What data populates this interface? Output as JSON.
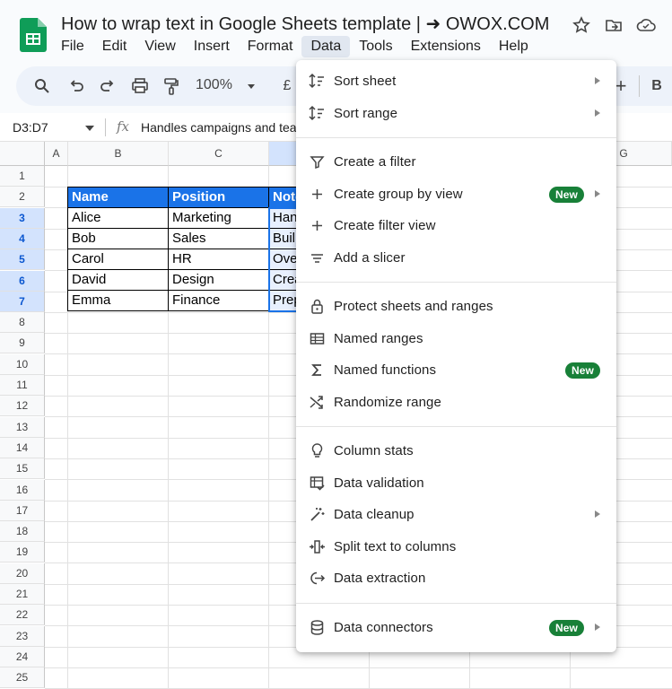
{
  "header": {
    "title": "How to wrap text in Google Sheets template | ➜ OWOX.COM",
    "menus": [
      "File",
      "Edit",
      "View",
      "Insert",
      "Format",
      "Data",
      "Tools",
      "Extensions",
      "Help"
    ],
    "active_menu": "Data"
  },
  "toolbar": {
    "zoom": "100%",
    "currency": "£",
    "bold": "B",
    "plus": "+"
  },
  "formula_bar": {
    "name_box": "D3:D7",
    "fx": "fx",
    "content": "Handles campaigns and tear"
  },
  "grid": {
    "columns": [
      "A",
      "B",
      "C",
      "",
      "G"
    ],
    "rows": [
      "1",
      "2",
      "3",
      "4",
      "5",
      "6",
      "7",
      "8",
      "9",
      "10",
      "11",
      "12",
      "13",
      "14",
      "15",
      "16",
      "17",
      "18",
      "19",
      "20",
      "21",
      "22",
      "23",
      "24",
      "25"
    ],
    "table_headers": [
      "Name",
      "Position",
      "Note"
    ],
    "table_rows": [
      [
        "Alice",
        "Marketing",
        "Han"
      ],
      [
        "Bob",
        "Sales",
        "Buil"
      ],
      [
        "Carol",
        "HR",
        "Ove"
      ],
      [
        "David",
        "Design",
        "Crea"
      ],
      [
        "Emma",
        "Finance",
        "Prep"
      ]
    ]
  },
  "data_menu": {
    "items": [
      {
        "label": "Sort sheet",
        "icon": "sort-sheet-icon"
      },
      {
        "label": "Sort range",
        "icon": "sort-range-icon"
      },
      {
        "label": "Create a filter",
        "icon": "filter-icon"
      },
      {
        "label": "Create group by view",
        "icon": "plus-icon",
        "badge": "New"
      },
      {
        "label": "Create filter view",
        "icon": "plus-icon"
      },
      {
        "label": "Add a slicer",
        "icon": "slicer-icon"
      },
      {
        "label": "Protect sheets and ranges",
        "icon": "lock-icon"
      },
      {
        "label": "Named ranges",
        "icon": "table-icon"
      },
      {
        "label": "Named functions",
        "icon": "sigma-icon",
        "badge": "New"
      },
      {
        "label": "Randomize range",
        "icon": "shuffle-icon"
      },
      {
        "label": "Column stats",
        "icon": "lightbulb-icon"
      },
      {
        "label": "Data validation",
        "icon": "validation-icon"
      },
      {
        "label": "Data cleanup",
        "icon": "magic-wand-icon"
      },
      {
        "label": "Split text to columns",
        "icon": "split-icon"
      },
      {
        "label": "Data extraction",
        "icon": "extract-icon"
      },
      {
        "label": "Data connectors",
        "icon": "database-icon",
        "badge": "New"
      }
    ]
  },
  "colors": {
    "accent": "#1a73e8",
    "badge": "#188038",
    "selection": "#d3e3fd"
  }
}
